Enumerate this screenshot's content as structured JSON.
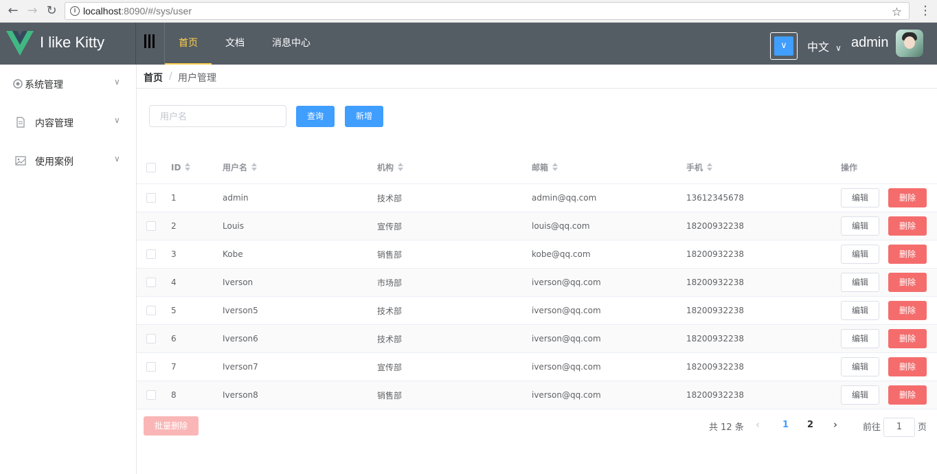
{
  "browser": {
    "url_host": "localhost",
    "url_path": ":8090/#/sys/user"
  },
  "header": {
    "app_title": "I like Kitty",
    "menu": [
      {
        "label": "首页",
        "active": true
      },
      {
        "label": "文档",
        "active": false
      },
      {
        "label": "消息中心",
        "active": false
      }
    ],
    "language": "中文",
    "user": "admin",
    "accent": "#ffd04b",
    "bg": "#545c64"
  },
  "sidebar": {
    "items": [
      {
        "label": "系统管理",
        "icon": "gear-icon"
      },
      {
        "label": "内容管理",
        "icon": "document-icon"
      },
      {
        "label": "使用案例",
        "icon": "picture-icon"
      }
    ]
  },
  "breadcrumb": {
    "home": "首页",
    "separator": "/",
    "current": "用户管理"
  },
  "toolbar": {
    "search_placeholder": "用户名",
    "query_label": "查询",
    "add_label": "新增"
  },
  "table": {
    "columns": {
      "id": "ID",
      "name": "用户名",
      "dept": "机构",
      "email": "邮箱",
      "mobile": "手机",
      "actions": "操作"
    },
    "edit_label": "编辑",
    "delete_label": "删除",
    "rows": [
      {
        "id": "1",
        "name": "admin",
        "dept": "技术部",
        "email": "admin@qq.com",
        "mobile": "13612345678"
      },
      {
        "id": "2",
        "name": "Louis",
        "dept": "宣传部",
        "email": "louis@qq.com",
        "mobile": "18200932238"
      },
      {
        "id": "3",
        "name": "Kobe",
        "dept": "销售部",
        "email": "kobe@qq.com",
        "mobile": "18200932238"
      },
      {
        "id": "4",
        "name": "Iverson",
        "dept": "市场部",
        "email": "iverson@qq.com",
        "mobile": "18200932238"
      },
      {
        "id": "5",
        "name": "Iverson5",
        "dept": "技术部",
        "email": "iverson@qq.com",
        "mobile": "18200932238"
      },
      {
        "id": "6",
        "name": "Iverson6",
        "dept": "技术部",
        "email": "iverson@qq.com",
        "mobile": "18200932238"
      },
      {
        "id": "7",
        "name": "Iverson7",
        "dept": "宣传部",
        "email": "iverson@qq.com",
        "mobile": "18200932238"
      },
      {
        "id": "8",
        "name": "Iverson8",
        "dept": "销售部",
        "email": "iverson@qq.com",
        "mobile": "18200932238"
      }
    ]
  },
  "footer": {
    "batch_delete_label": "批量删除",
    "total_text": "共 12 条",
    "pages": [
      "1",
      "2"
    ],
    "current_page": "1",
    "goto_label": "前往",
    "goto_value": "1",
    "page_suffix": "页",
    "primary": "#409eff",
    "danger": "#f56c6c"
  }
}
